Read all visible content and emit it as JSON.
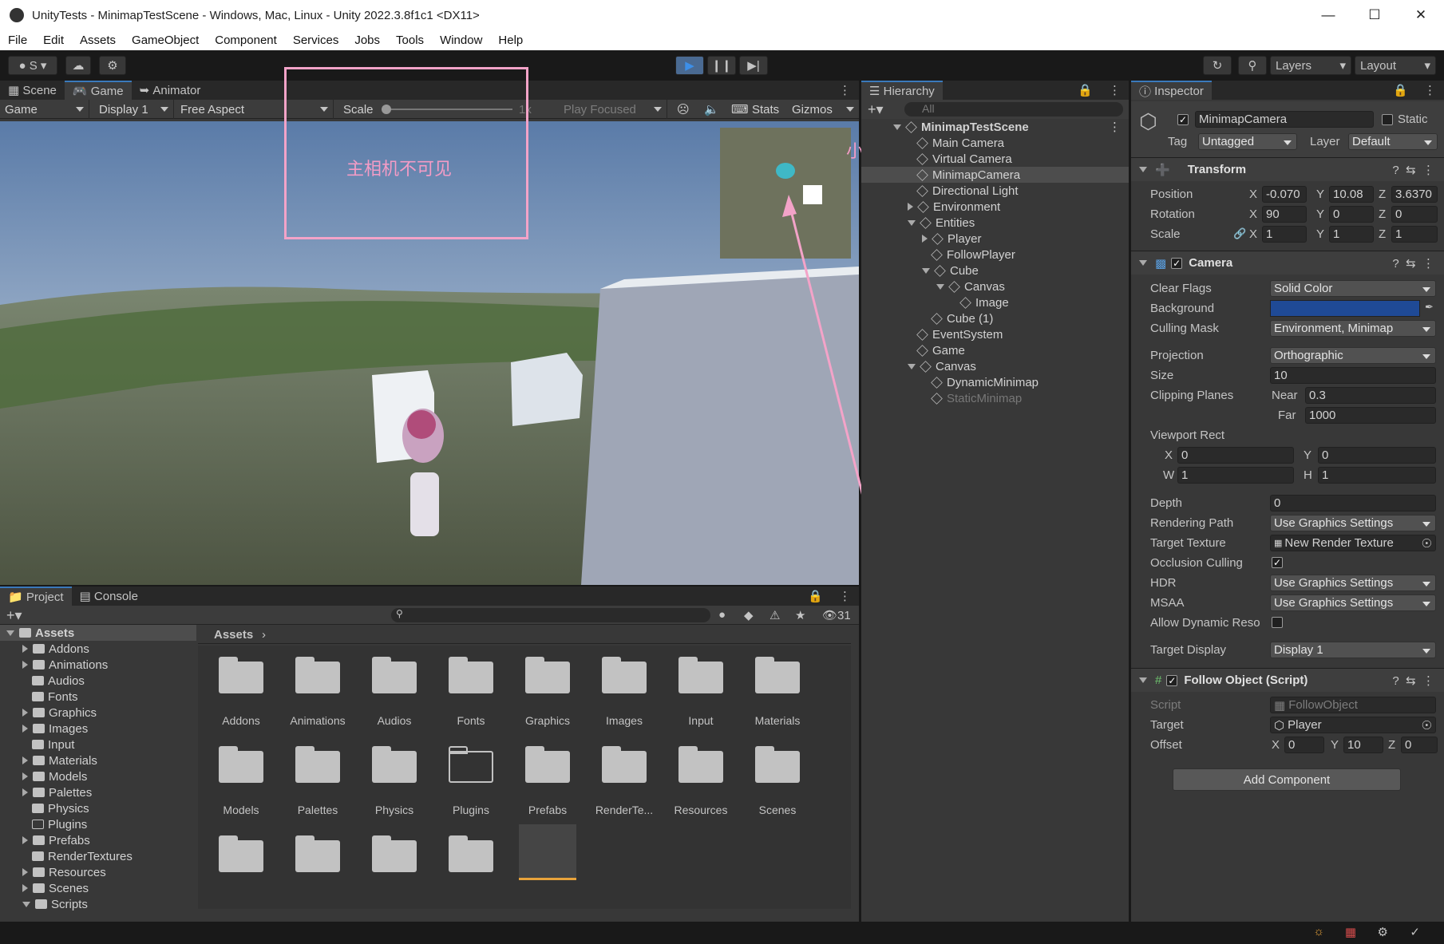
{
  "window": {
    "title": "UnityTests - MinimapTestScene - Windows, Mac, Linux - Unity 2022.3.8f1c1 <DX11>"
  },
  "menu": [
    "File",
    "Edit",
    "Assets",
    "GameObject",
    "Component",
    "Services",
    "Jobs",
    "Tools",
    "Window",
    "Help"
  ],
  "toolbar": {
    "account": "S",
    "layers": "Layers",
    "layout": "Layout"
  },
  "game_view": {
    "tabs": [
      "Scene",
      "Game",
      "Animator"
    ],
    "game_dd": "Game",
    "display_dd": "Display 1",
    "aspect_dd": "Free Aspect",
    "scale_label": "Scale",
    "scale_value": "1x",
    "play_focused": "Play Focused",
    "stats": "Stats",
    "gizmos": "Gizmos"
  },
  "annotations": {
    "main_camera_note": "主相机不可见",
    "minimap_note": "小地图可见"
  },
  "hierarchy": {
    "title": "Hierarchy",
    "search_placeholder": "All",
    "rows": [
      {
        "label": "MinimapTestScene",
        "indent": 0,
        "arrow": "down",
        "bold": true,
        "icon": "unity-scene-icon"
      },
      {
        "label": "Main Camera",
        "indent": 1,
        "arrow": "",
        "icon": "cube-icon"
      },
      {
        "label": "Virtual Camera",
        "indent": 1,
        "arrow": "",
        "icon": "cube-icon"
      },
      {
        "label": "MinimapCamera",
        "indent": 1,
        "arrow": "",
        "icon": "cube-icon",
        "selected": true
      },
      {
        "label": "Directional Light",
        "indent": 1,
        "arrow": "",
        "icon": "cube-icon"
      },
      {
        "label": "Environment",
        "indent": 1,
        "arrow": "right",
        "icon": "cube-icon"
      },
      {
        "label": "Entities",
        "indent": 1,
        "arrow": "down",
        "icon": "cube-icon"
      },
      {
        "label": "Player",
        "indent": 2,
        "arrow": "right",
        "icon": "cube-icon"
      },
      {
        "label": "FollowPlayer",
        "indent": 2,
        "arrow": "",
        "icon": "cube-icon"
      },
      {
        "label": "Cube",
        "indent": 2,
        "arrow": "down",
        "icon": "cube-icon"
      },
      {
        "label": "Canvas",
        "indent": 3,
        "arrow": "down",
        "icon": "cube-icon"
      },
      {
        "label": "Image",
        "indent": 4,
        "arrow": "",
        "icon": "cube-icon"
      },
      {
        "label": "Cube (1)",
        "indent": 2,
        "arrow": "",
        "icon": "cube-icon"
      },
      {
        "label": "EventSystem",
        "indent": 1,
        "arrow": "",
        "icon": "cube-icon"
      },
      {
        "label": "Game",
        "indent": 1,
        "arrow": "",
        "icon": "cube-icon"
      },
      {
        "label": "Canvas",
        "indent": 1,
        "arrow": "down",
        "icon": "cube-icon"
      },
      {
        "label": "DynamicMinimap",
        "indent": 2,
        "arrow": "",
        "icon": "cube-icon"
      },
      {
        "label": "StaticMinimap",
        "indent": 2,
        "arrow": "",
        "icon": "cube-icon",
        "disabled": true
      }
    ]
  },
  "inspector": {
    "title": "Inspector",
    "object_name": "MinimapCamera",
    "static_label": "Static",
    "tag_label": "Tag",
    "tag_value": "Untagged",
    "layer_label": "Layer",
    "layer_value": "Default",
    "transform": {
      "title": "Transform",
      "position_label": "Position",
      "rotation_label": "Rotation",
      "scale_label": "Scale",
      "pos": [
        "-0.070",
        "10.08",
        "3.6370"
      ],
      "rot": [
        "90",
        "0",
        "0"
      ],
      "scl": [
        "1",
        "1",
        "1"
      ]
    },
    "camera": {
      "title": "Camera",
      "clear_flags_label": "Clear Flags",
      "clear_flags": "Solid Color",
      "background_label": "Background",
      "background_color": "#1f4a96",
      "culling_mask_label": "Culling Mask",
      "culling_mask": "Environment, Minimap",
      "projection_label": "Projection",
      "projection": "Orthographic",
      "size_label": "Size",
      "size": "10",
      "clipping_label": "Clipping Planes",
      "near_label": "Near",
      "near": "0.3",
      "far_label": "Far",
      "far": "1000",
      "viewport_label": "Viewport Rect",
      "vx": "0",
      "vy": "0",
      "vw": "1",
      "vh": "1",
      "depth_label": "Depth",
      "depth": "0",
      "rendering_path_label": "Rendering Path",
      "rendering_path": "Use Graphics Settings",
      "target_texture_label": "Target Texture",
      "target_texture": "New Render Texture",
      "occlusion_label": "Occlusion Culling",
      "hdr_label": "HDR",
      "hdr": "Use Graphics Settings",
      "msaa_label": "MSAA",
      "msaa": "Use Graphics Settings",
      "allow_dyn_label": "Allow Dynamic Reso",
      "target_display_label": "Target Display",
      "target_display": "Display 1"
    },
    "follow": {
      "title": "Follow Object (Script)",
      "script_label": "Script",
      "script": "FollowObject",
      "target_label": "Target",
      "target": "Player",
      "offset_label": "Offset",
      "ox": "0",
      "oy": "10",
      "oz": "0"
    },
    "add_component": "Add Component"
  },
  "project": {
    "tabs": [
      "Project",
      "Console"
    ],
    "breadcrumb": "Assets",
    "hidden_count": "31",
    "tree": [
      {
        "label": "Assets",
        "indent": 0,
        "arrow": "down",
        "bold": true
      },
      {
        "label": "Addons",
        "indent": 1,
        "arrow": "right"
      },
      {
        "label": "Animations",
        "indent": 1,
        "arrow": "right"
      },
      {
        "label": "Audios",
        "indent": 1,
        "arrow": ""
      },
      {
        "label": "Fonts",
        "indent": 1,
        "arrow": ""
      },
      {
        "label": "Graphics",
        "indent": 1,
        "arrow": "right"
      },
      {
        "label": "Images",
        "indent": 1,
        "arrow": "right"
      },
      {
        "label": "Input",
        "indent": 1,
        "arrow": ""
      },
      {
        "label": "Materials",
        "indent": 1,
        "arrow": "right"
      },
      {
        "label": "Models",
        "indent": 1,
        "arrow": "right"
      },
      {
        "label": "Palettes",
        "indent": 1,
        "arrow": "right"
      },
      {
        "label": "Physics",
        "indent": 1,
        "arrow": ""
      },
      {
        "label": "Plugins",
        "indent": 1,
        "arrow": "",
        "empty": true
      },
      {
        "label": "Prefabs",
        "indent": 1,
        "arrow": "right"
      },
      {
        "label": "RenderTextures",
        "indent": 1,
        "arrow": ""
      },
      {
        "label": "Resources",
        "indent": 1,
        "arrow": "right"
      },
      {
        "label": "Scenes",
        "indent": 1,
        "arrow": "right"
      },
      {
        "label": "Scripts",
        "indent": 1,
        "arrow": "down"
      }
    ],
    "grid": [
      "Addons",
      "Animations",
      "Audios",
      "Fonts",
      "Graphics",
      "Images",
      "Input",
      "Materials",
      "Models",
      "Palettes",
      "Physics",
      "Plugins",
      "Prefabs",
      "RenderTe...",
      "Resources",
      "Scenes"
    ]
  }
}
